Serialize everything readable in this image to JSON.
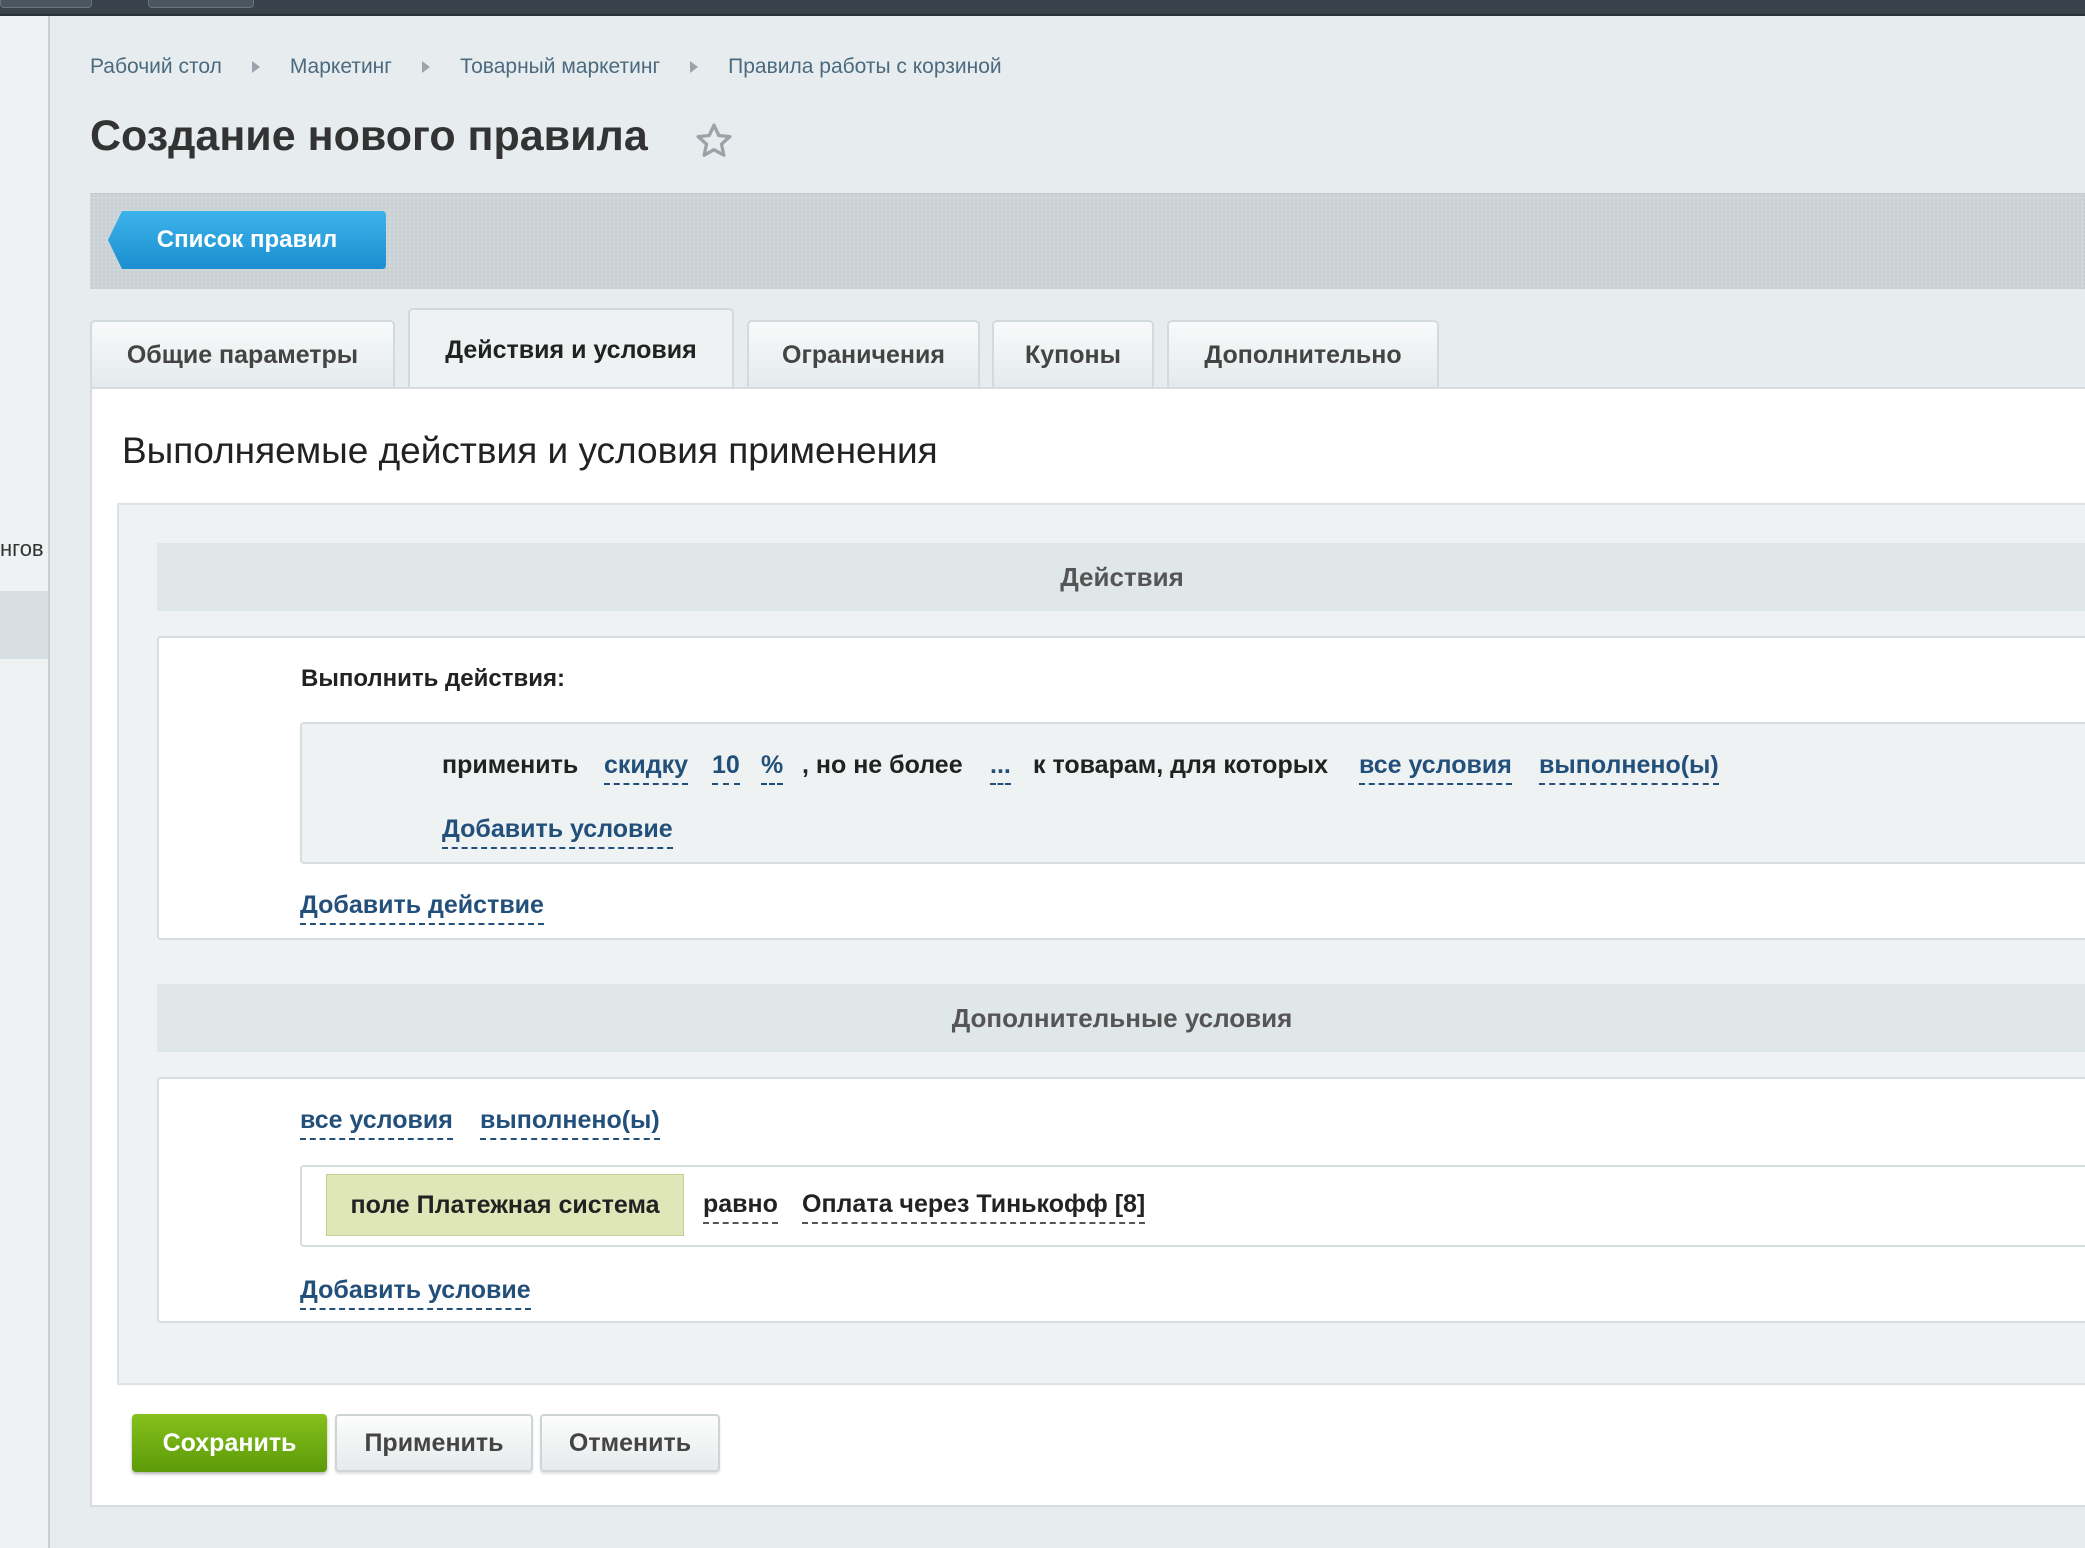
{
  "breadcrumb": [
    "Рабочий стол",
    "Маркетинг",
    "Товарный маркетинг",
    "Правила работы с корзиной"
  ],
  "page": {
    "title": "Создание нового правила",
    "favorite_icon": "star-outline-icon"
  },
  "sidebar": {
    "cut_label": "нгов"
  },
  "toolbar": {
    "list_button": "Список правил"
  },
  "tabs": [
    {
      "label": "Общие параметры",
      "active": false
    },
    {
      "label": "Действия и условия",
      "active": true
    },
    {
      "label": "Ограничения",
      "active": false
    },
    {
      "label": "Купоны",
      "active": false
    },
    {
      "label": "Дополнительно",
      "active": false
    }
  ],
  "content": {
    "heading": "Выполняемые действия и условия применения",
    "actions_section": {
      "title": "Действия",
      "label": "Выполнить действия:",
      "sentence": {
        "apply": "применить",
        "type": "скидку",
        "value": "10",
        "unit": "%",
        "max_text": ", но не более",
        "max_value": "...",
        "target_text": "к товарам, для которых",
        "logic": "все условия",
        "state": "выполнено(ы)"
      },
      "add_condition": "Добавить условие",
      "add_action": "Добавить действие"
    },
    "extra_section": {
      "title": "Дополнительные условия",
      "logic": "все условия",
      "state": "выполнено(ы)",
      "condition": {
        "field": "поле Платежная система",
        "operator": "равно",
        "value": "Оплата через Тинькофф [8]"
      },
      "add_condition": "Добавить условие"
    }
  },
  "buttons": {
    "save": "Сохранить",
    "apply": "Применить",
    "cancel": "Отменить"
  },
  "colors": {
    "accent_blue": "#1a8ed0",
    "save_green": "#6aa80f",
    "link": "#22507a",
    "chip": "#dfe6b8"
  }
}
